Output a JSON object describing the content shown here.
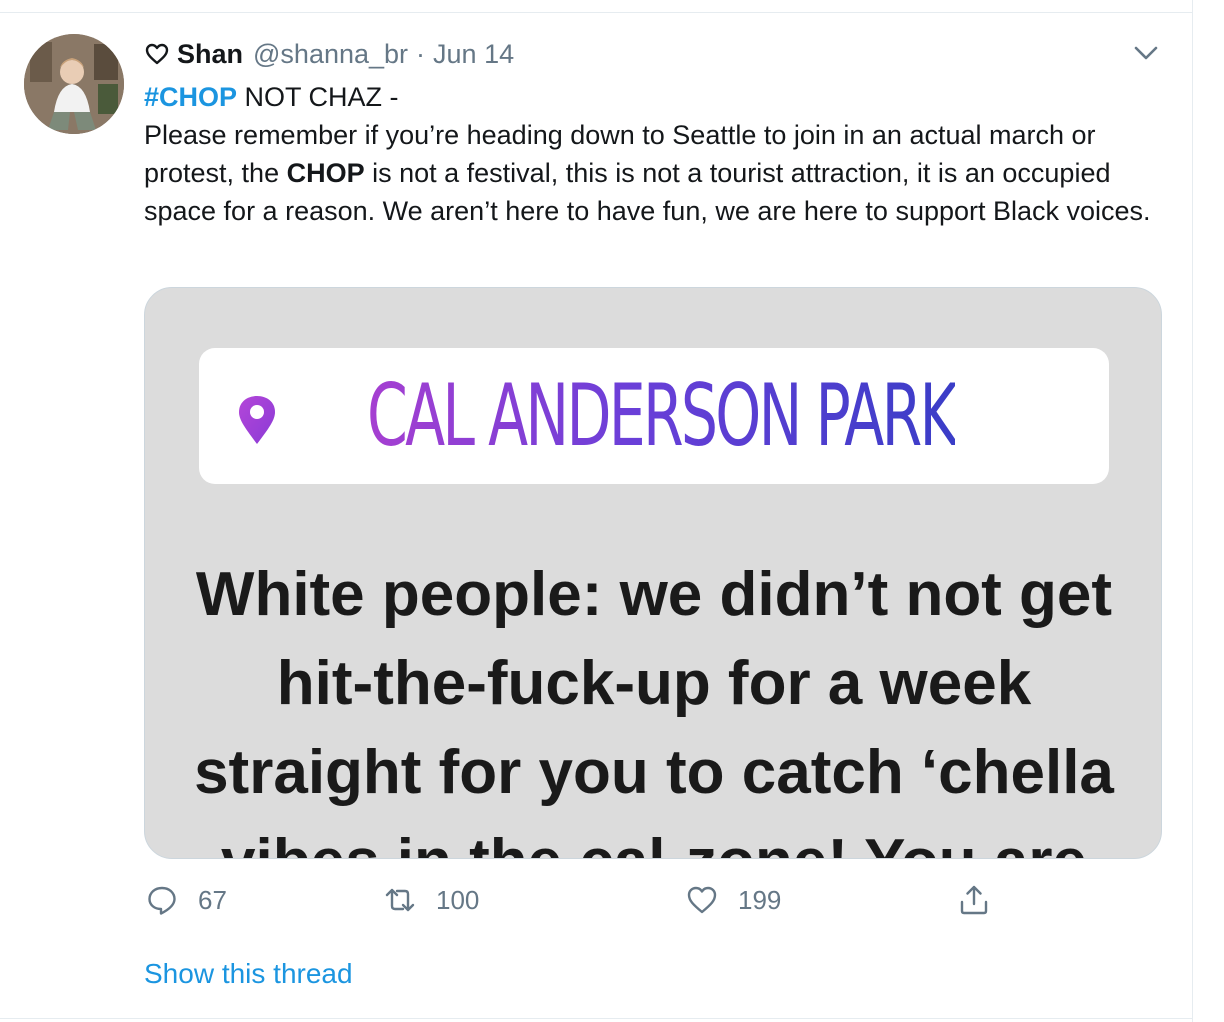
{
  "tweet": {
    "author": {
      "display_name": "Shan",
      "handle": "@shanna_br",
      "name_icon": "heart-outline-icon"
    },
    "separator": "·",
    "date": "Jun 14",
    "menu_icon": "chevron-down-icon",
    "text": {
      "hashtag": "#CHOP",
      "line1_rest": " NOT CHAZ -",
      "body_part1": "Please remember if you’re heading down to Seattle to join in an actual march or protest, the ",
      "body_bold": "CHOP",
      "body_part2": " is not a festival, this is not a tourist attraction, it is an occupied space for a reason. We aren’t here to have fun, we are here to support Black voices."
    },
    "media": {
      "location_icon": "location-pin-icon",
      "location_label": "CAL ANDERSON PARK",
      "text_lines": [
        "White people: we didn’t not get",
        "hit-the-fuck-up for a week",
        "straight for you to catch ‘chella",
        "vibes in the cal-zone! You are"
      ]
    },
    "actions": {
      "reply": {
        "icon": "reply-icon",
        "count": "67"
      },
      "retweet": {
        "icon": "retweet-icon",
        "count": "100"
      },
      "like": {
        "icon": "heart-icon",
        "count": "199"
      },
      "share": {
        "icon": "share-icon"
      }
    },
    "show_thread": "Show this thread"
  },
  "colors": {
    "link": "#1b95e0",
    "secondary_text": "#657786",
    "primary_text": "#14171a",
    "location_gradient_start": "#a63fd1",
    "location_gradient_end": "#3a3dc7",
    "media_background": "#dcdcdc"
  }
}
